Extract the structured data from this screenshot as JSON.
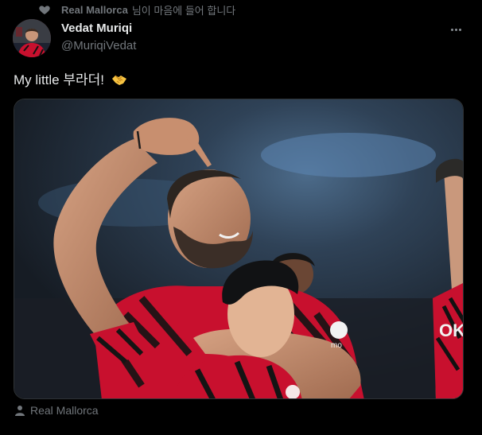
{
  "social_context": {
    "account": "Real Mallorca",
    "text": "님이 마음에 들어 합니다"
  },
  "author": {
    "display_name": "Vedat Muriqi",
    "handle": "@MuriqiVedat"
  },
  "tweet": {
    "text": "My little 부라더!",
    "emoji": "handshake"
  },
  "media": {
    "alt": "Vedat Muriqi pointing down at a teammate while hugging him"
  },
  "media_tag": {
    "label": "Real Mallorca",
    "icon": "person-icon"
  },
  "colors": {
    "background": "#000000",
    "text": "#e7e9ea",
    "muted": "#71767b",
    "jersey_red": "#c8102e"
  }
}
